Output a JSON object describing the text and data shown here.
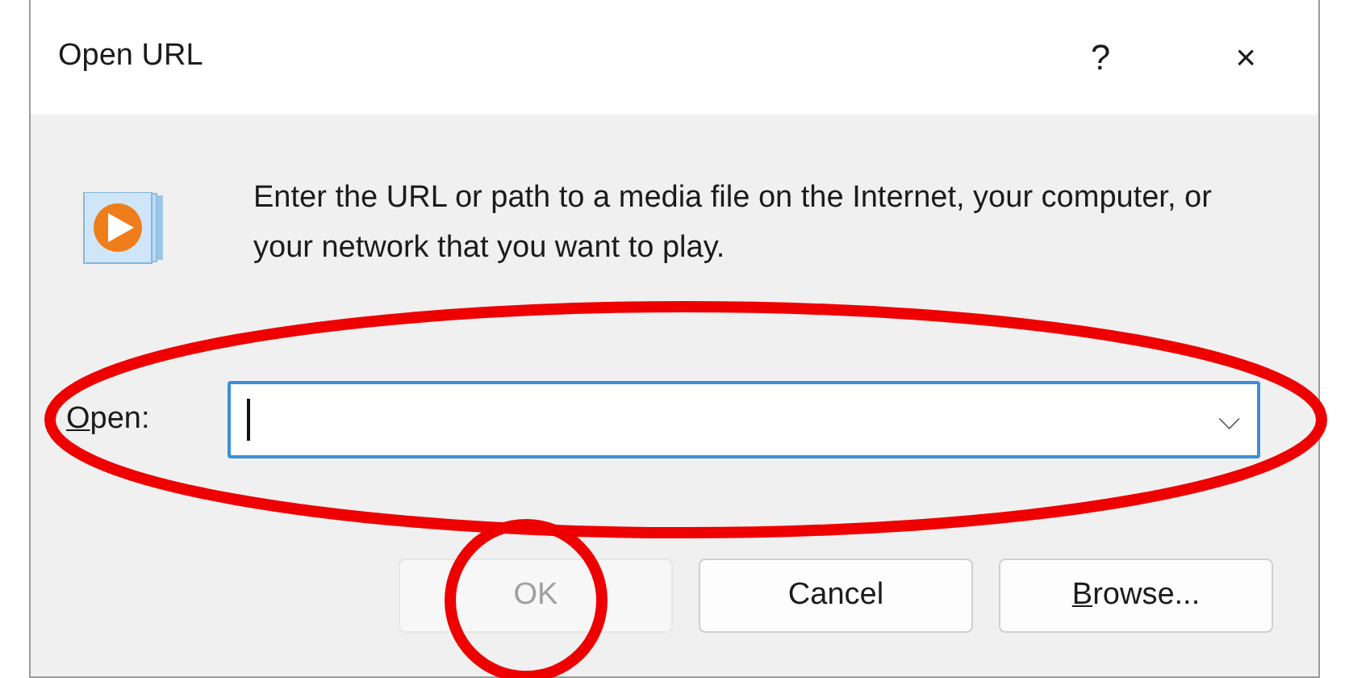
{
  "window": {
    "title": "Open URL",
    "help_button": "?",
    "close_button": "×"
  },
  "message": "Enter the URL or path to a media file on the Internet, your computer, or your network that you want to play.",
  "open_field": {
    "label": "Open:",
    "label_underline_first": true,
    "focused": true,
    "dropdown": "⌵"
  },
  "buttons": [
    {
      "label": "OK",
      "disabled": true,
      "underline_first": false
    },
    {
      "label": "Cancel",
      "disabled": false,
      "underline_first": false
    },
    {
      "label": "Browse...",
      "disabled": false,
      "underline_first": true
    }
  ],
  "annotations": [
    {
      "kind": "ellipse"
    },
    {
      "kind": "circle"
    }
  ]
}
